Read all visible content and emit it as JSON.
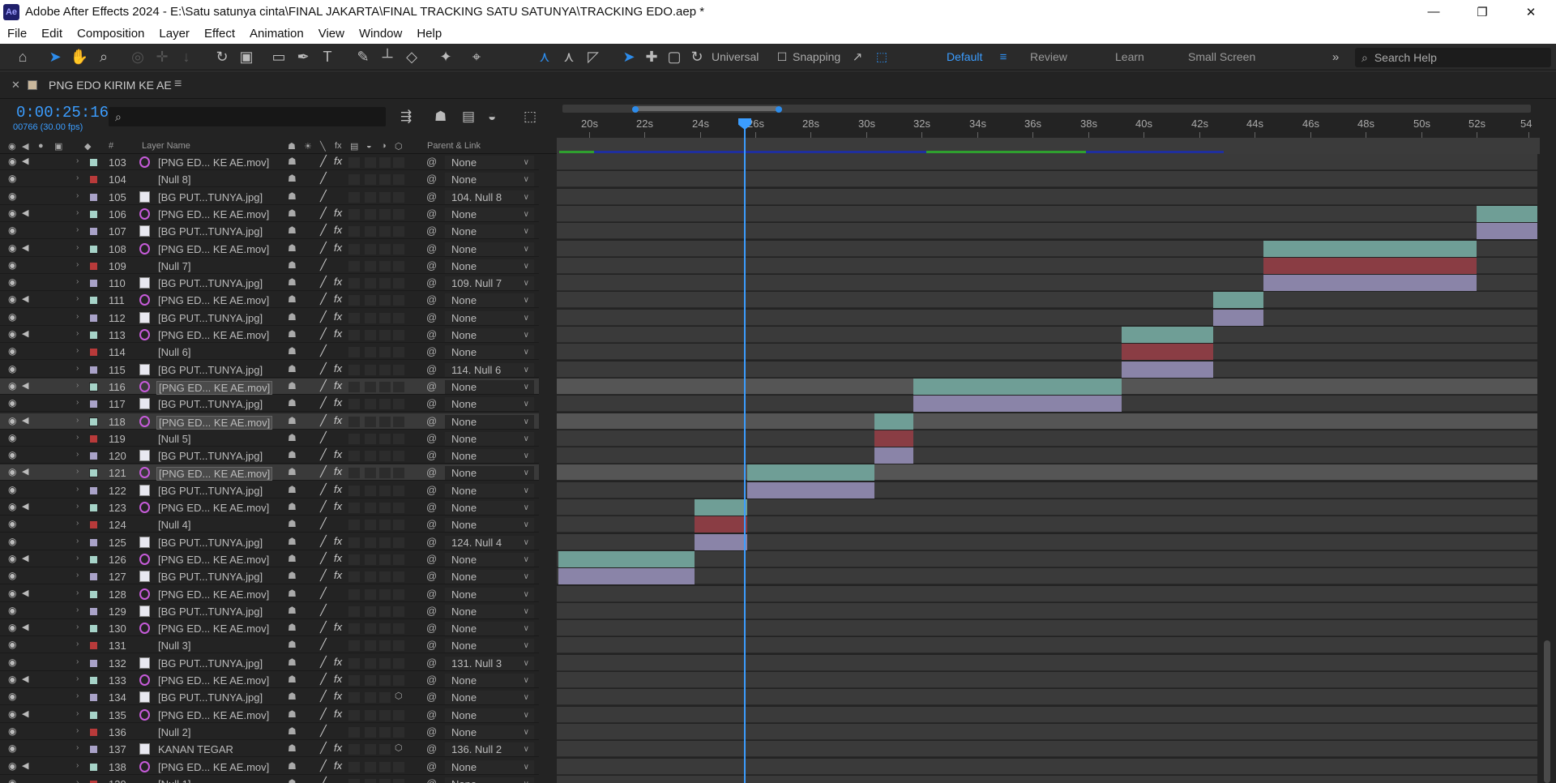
{
  "window": {
    "app_icon": "Ae",
    "title": "Adobe After Effects 2024 - E:\\Satu satunya cinta\\FINAL JAKARTA\\FINAL TRACKING SATU SATUNYA\\TRACKING EDO.aep *"
  },
  "menu": [
    "File",
    "Edit",
    "Composition",
    "Layer",
    "Effect",
    "Animation",
    "View",
    "Window",
    "Help"
  ],
  "toolbar": {
    "axis_mode": "Universal",
    "snapping": "Snapping",
    "workspaces": [
      "Default",
      "Review",
      "Learn",
      "Small Screen"
    ],
    "search_placeholder": "Search Help"
  },
  "comp": {
    "name": "PNG EDO KIRIM KE AE",
    "timecode": "0:00:25:16",
    "frames": "00766 (30.00 fps)",
    "search_placeholder": "⌕"
  },
  "columns": {
    "num": "#",
    "layer_name": "Layer Name",
    "parent": "Parent & Link"
  },
  "ruler": {
    "ticks": [
      "20s",
      "22s",
      "24s",
      "26s",
      "28s",
      "30s",
      "32s",
      "34s",
      "36s",
      "38s",
      "40s",
      "42s",
      "44s",
      "46s",
      "48s",
      "50s",
      "52s",
      "54"
    ]
  },
  "colors": {
    "accent": "#2d8ceb",
    "label_video": "#a6d3c8",
    "label_image": "#a9a2c8",
    "label_null": "#b83a3a",
    "bar_video": "#6f9e96",
    "bar_image": "#8a84a8",
    "bar_null": "#8a3d44"
  },
  "layers": [
    {
      "num": "103",
      "name": "[PNG ED... KE AE.mov]",
      "type": "mov",
      "fx": true,
      "audio": true,
      "parent": "None"
    },
    {
      "num": "104",
      "name": "[Null 8]",
      "type": "null",
      "fx": false,
      "audio": false,
      "parent": "None"
    },
    {
      "num": "105",
      "name": "[BG PUT...TUNYA.jpg]",
      "type": "img",
      "fx": false,
      "audio": false,
      "parent": "104. Null 8"
    },
    {
      "num": "106",
      "name": "[PNG ED... KE AE.mov]",
      "type": "mov",
      "fx": true,
      "audio": true,
      "parent": "None"
    },
    {
      "num": "107",
      "name": "[BG PUT...TUNYA.jpg]",
      "type": "img",
      "fx": true,
      "audio": false,
      "parent": "None"
    },
    {
      "num": "108",
      "name": "[PNG ED... KE AE.mov]",
      "type": "mov",
      "fx": true,
      "audio": true,
      "parent": "None"
    },
    {
      "num": "109",
      "name": "[Null 7]",
      "type": "null",
      "fx": false,
      "audio": false,
      "parent": "None"
    },
    {
      "num": "110",
      "name": "[BG PUT...TUNYA.jpg]",
      "type": "img",
      "fx": true,
      "audio": false,
      "parent": "109. Null 7"
    },
    {
      "num": "111",
      "name": "[PNG ED... KE AE.mov]",
      "type": "mov",
      "fx": true,
      "audio": true,
      "parent": "None"
    },
    {
      "num": "112",
      "name": "[BG PUT...TUNYA.jpg]",
      "type": "img",
      "fx": true,
      "audio": false,
      "parent": "None"
    },
    {
      "num": "113",
      "name": "[PNG ED... KE AE.mov]",
      "type": "mov",
      "fx": true,
      "audio": true,
      "parent": "None"
    },
    {
      "num": "114",
      "name": "[Null 6]",
      "type": "null",
      "fx": false,
      "audio": false,
      "parent": "None"
    },
    {
      "num": "115",
      "name": "[BG PUT...TUNYA.jpg]",
      "type": "img",
      "fx": true,
      "audio": false,
      "parent": "114. Null 6"
    },
    {
      "num": "116",
      "name": "[PNG ED... KE AE.mov]",
      "type": "mov",
      "fx": true,
      "audio": true,
      "parent": "None",
      "selected": true
    },
    {
      "num": "117",
      "name": "[BG PUT...TUNYA.jpg]",
      "type": "img",
      "fx": true,
      "audio": false,
      "parent": "None"
    },
    {
      "num": "118",
      "name": "[PNG ED... KE AE.mov]",
      "type": "mov",
      "fx": true,
      "audio": true,
      "parent": "None",
      "selected": true
    },
    {
      "num": "119",
      "name": "[Null 5]",
      "type": "null",
      "fx": false,
      "audio": false,
      "parent": "None"
    },
    {
      "num": "120",
      "name": "[BG PUT...TUNYA.jpg]",
      "type": "img",
      "fx": true,
      "audio": false,
      "parent": "None"
    },
    {
      "num": "121",
      "name": "[PNG ED... KE AE.mov]",
      "type": "mov",
      "fx": true,
      "audio": true,
      "parent": "None",
      "selected": true
    },
    {
      "num": "122",
      "name": "[BG PUT...TUNYA.jpg]",
      "type": "img",
      "fx": true,
      "audio": false,
      "parent": "None"
    },
    {
      "num": "123",
      "name": "[PNG ED... KE AE.mov]",
      "type": "mov",
      "fx": true,
      "audio": true,
      "parent": "None"
    },
    {
      "num": "124",
      "name": "[Null 4]",
      "type": "null",
      "fx": false,
      "audio": false,
      "parent": "None"
    },
    {
      "num": "125",
      "name": "[BG PUT...TUNYA.jpg]",
      "type": "img",
      "fx": true,
      "audio": false,
      "parent": "124. Null 4"
    },
    {
      "num": "126",
      "name": "[PNG ED... KE AE.mov]",
      "type": "mov",
      "fx": true,
      "audio": true,
      "parent": "None"
    },
    {
      "num": "127",
      "name": "[BG PUT...TUNYA.jpg]",
      "type": "img",
      "fx": true,
      "audio": false,
      "parent": "None"
    },
    {
      "num": "128",
      "name": "[PNG ED... KE AE.mov]",
      "type": "mov",
      "fx": false,
      "audio": true,
      "parent": "None"
    },
    {
      "num": "129",
      "name": "[BG PUT...TUNYA.jpg]",
      "type": "img",
      "fx": false,
      "audio": false,
      "parent": "None"
    },
    {
      "num": "130",
      "name": "[PNG ED... KE AE.mov]",
      "type": "mov",
      "fx": true,
      "audio": true,
      "parent": "None"
    },
    {
      "num": "131",
      "name": "[Null 3]",
      "type": "null",
      "fx": false,
      "audio": false,
      "parent": "None"
    },
    {
      "num": "132",
      "name": "[BG PUT...TUNYA.jpg]",
      "type": "img",
      "fx": true,
      "audio": false,
      "parent": "131. Null 3"
    },
    {
      "num": "133",
      "name": "[PNG ED... KE AE.mov]",
      "type": "mov",
      "fx": true,
      "audio": true,
      "parent": "None"
    },
    {
      "num": "134",
      "name": "[BG PUT...TUNYA.jpg]",
      "type": "img",
      "fx": true,
      "audio": false,
      "parent": "None",
      "cube": true
    },
    {
      "num": "135",
      "name": "[PNG ED... KE AE.mov]",
      "type": "mov",
      "fx": true,
      "audio": true,
      "parent": "None"
    },
    {
      "num": "136",
      "name": "[Null 2]",
      "type": "null",
      "fx": false,
      "audio": false,
      "parent": "None"
    },
    {
      "num": "137",
      "name": "KANAN TEGAR",
      "type": "img",
      "fx": true,
      "audio": false,
      "parent": "136. Null 2",
      "cube": true
    },
    {
      "num": "138",
      "name": "[PNG ED... KE AE.mov]",
      "type": "mov",
      "fx": true,
      "audio": true,
      "parent": "None"
    },
    {
      "num": "139",
      "name": "[Null 1]",
      "type": "null",
      "fx": false,
      "audio": false,
      "parent": "None"
    }
  ],
  "timeline_bars": [
    {
      "layer": "106",
      "start_s": 52.0,
      "end_s": 54.3,
      "kind": "mov"
    },
    {
      "layer": "107",
      "start_s": 52.0,
      "end_s": 54.3,
      "kind": "img"
    },
    {
      "layer": "108",
      "start_s": 44.3,
      "end_s": 52.0,
      "kind": "mov"
    },
    {
      "layer": "109",
      "start_s": 44.3,
      "end_s": 52.0,
      "kind": "null"
    },
    {
      "layer": "110",
      "start_s": 44.3,
      "end_s": 52.0,
      "kind": "img"
    },
    {
      "layer": "111",
      "start_s": 42.5,
      "end_s": 44.3,
      "kind": "mov"
    },
    {
      "layer": "112",
      "start_s": 42.5,
      "end_s": 44.3,
      "kind": "img"
    },
    {
      "layer": "113",
      "start_s": 39.2,
      "end_s": 42.5,
      "kind": "mov"
    },
    {
      "layer": "114",
      "start_s": 39.2,
      "end_s": 42.5,
      "kind": "null"
    },
    {
      "layer": "115",
      "start_s": 39.2,
      "end_s": 42.5,
      "kind": "img"
    },
    {
      "layer": "116",
      "start_s": 31.7,
      "end_s": 39.2,
      "kind": "mov"
    },
    {
      "layer": "117",
      "start_s": 31.7,
      "end_s": 39.2,
      "kind": "img"
    },
    {
      "layer": "118",
      "start_s": 30.3,
      "end_s": 31.7,
      "kind": "mov"
    },
    {
      "layer": "119",
      "start_s": 30.3,
      "end_s": 31.7,
      "kind": "null"
    },
    {
      "layer": "120",
      "start_s": 30.3,
      "end_s": 31.7,
      "kind": "img"
    },
    {
      "layer": "121",
      "start_s": 25.7,
      "end_s": 30.3,
      "kind": "mov"
    },
    {
      "layer": "122",
      "start_s": 25.7,
      "end_s": 30.3,
      "kind": "img"
    },
    {
      "layer": "123",
      "start_s": 23.8,
      "end_s": 25.7,
      "kind": "mov"
    },
    {
      "layer": "124",
      "start_s": 23.8,
      "end_s": 25.7,
      "kind": "null"
    },
    {
      "layer": "125",
      "start_s": 23.8,
      "end_s": 25.7,
      "kind": "img"
    },
    {
      "layer": "126",
      "start_s": 18.9,
      "end_s": 23.8,
      "kind": "mov"
    },
    {
      "layer": "127",
      "start_s": 18.9,
      "end_s": 23.8,
      "kind": "img"
    }
  ]
}
